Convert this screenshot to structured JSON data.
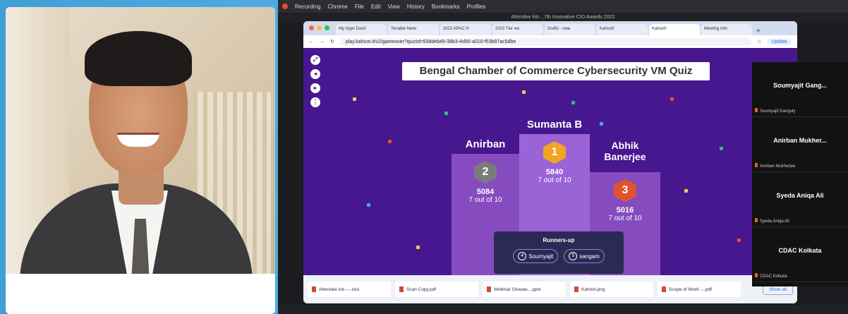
{
  "browser": {
    "tabs": [
      "My Apps Dash",
      "Tenable Netw",
      "2022 APAC H",
      "2022 Tier wo",
      "Drafts - swa",
      "Kahoot!",
      "Kahoot!",
      "Meeting Info"
    ],
    "url": "play.kahoot.it/v2/gameover?quizId=93ddeb49-38b3-4d90-a010-f53b97ac5dbe",
    "update_label": "Update"
  },
  "zoom": {
    "window_title": "Attendee list-...7th Innovative CIO Awards 2022",
    "menu": [
      "Chrome",
      "File",
      "Edit",
      "View",
      "History",
      "Bookmarks",
      "Profiles"
    ],
    "recording_label": "Recording"
  },
  "kahoot": {
    "title": "Bengal Chamber of Commerce Cybersecurity VM Quiz",
    "podium": [
      {
        "rank": "2",
        "name": "Anirban",
        "score": "5084",
        "correct": "7 out of 10"
      },
      {
        "rank": "1",
        "name": "Sumanta B",
        "score": "5840",
        "correct": "7 out of 10"
      },
      {
        "rank": "3",
        "name": "Abhik Banerjee",
        "score": "5016",
        "correct": "7 out of 10"
      }
    ],
    "runners_title": "Runners-up",
    "runners": [
      {
        "rank": "4",
        "name": "Soumyajit"
      },
      {
        "rank": "5",
        "name": "sangam"
      }
    ]
  },
  "participants": [
    {
      "name": "Soumyajit Gang...",
      "label": "Soumyajit Ganguly"
    },
    {
      "name": "Anirban Mukher...",
      "label": "Anirban Mukherjee"
    },
    {
      "name": "Syeda Aniqa Ali",
      "label": "Syeda Aniqa Ali"
    },
    {
      "name": "CDAC Kolkata",
      "label": "CDAC Kolkata"
    }
  ],
  "downloads": {
    "items": [
      "Attendee list----.xlsx",
      "Scan Copy.pdf",
      "Webinar Giveaw....pptx",
      "Kahoot.png",
      "Scope of Work -...pdf"
    ],
    "show_all": "Show all"
  }
}
